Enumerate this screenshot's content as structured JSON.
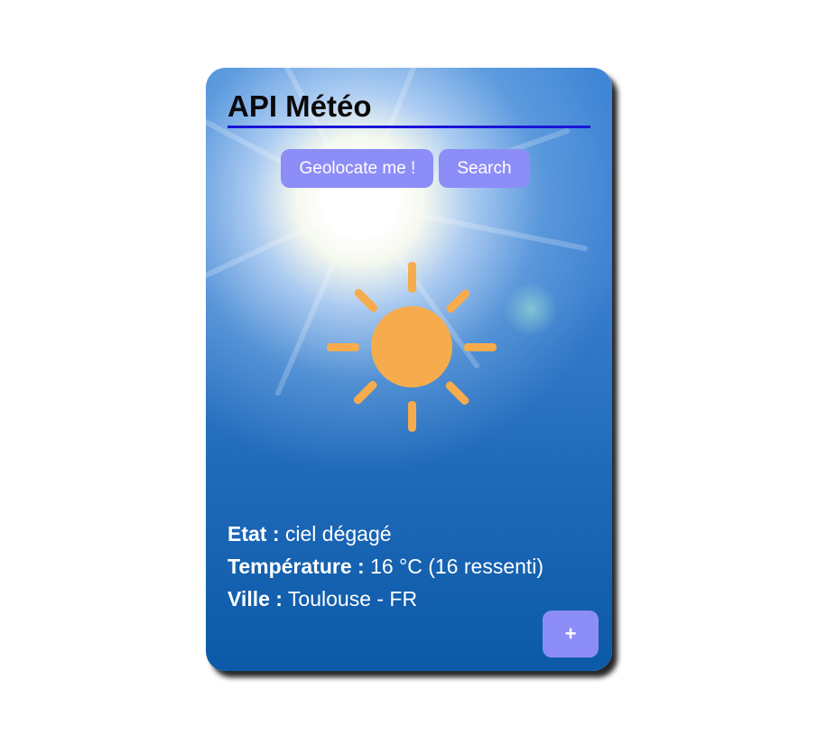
{
  "app": {
    "title": "API Météo"
  },
  "actions": {
    "geolocate_label": "Geolocate me !",
    "search_label": "Search",
    "more_label": "+"
  },
  "weather": {
    "icon": "sun-icon",
    "state_label": "Etat :",
    "state_value": "ciel dégagé",
    "temperature_label": "Température :",
    "temperature_value": "16 °C (16 ressenti)",
    "city_label": "Ville :",
    "city_value": "Toulouse - FR"
  },
  "colors": {
    "accent_button": "#8d8df8",
    "title_underline": "#1a14d8",
    "sun": "#f6ac4c",
    "sky": "#1e68b8"
  }
}
